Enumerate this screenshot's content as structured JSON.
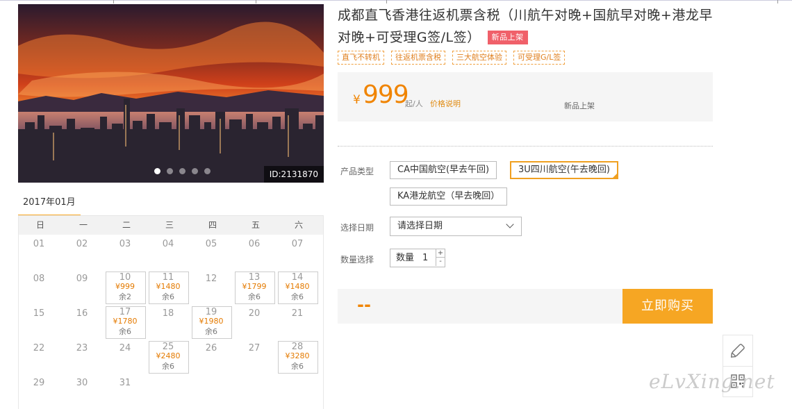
{
  "hero": {
    "image_id": "ID:2131870",
    "slide_count": 5,
    "active_slide": 1
  },
  "calendar": {
    "month": "2017年01月",
    "weekdays": [
      "日",
      "一",
      "二",
      "三",
      "四",
      "五",
      "六"
    ],
    "rows": [
      [
        {
          "d": "01"
        },
        {
          "d": "02"
        },
        {
          "d": "03"
        },
        {
          "d": "04"
        },
        {
          "d": "05"
        },
        {
          "d": "06"
        },
        {
          "d": "07"
        }
      ],
      [
        {
          "d": "08"
        },
        {
          "d": "09"
        },
        {
          "d": "10",
          "price": "¥999",
          "rem": "余2"
        },
        {
          "d": "11",
          "price": "¥1480",
          "rem": "余6"
        },
        {
          "d": "12"
        },
        {
          "d": "13",
          "price": "¥1799",
          "rem": "余6"
        },
        {
          "d": "14",
          "price": "¥1480",
          "rem": "余6"
        }
      ],
      [
        {
          "d": "15"
        },
        {
          "d": "16"
        },
        {
          "d": "17",
          "price": "¥1780",
          "rem": "余6"
        },
        {
          "d": "18"
        },
        {
          "d": "19",
          "price": "¥1980",
          "rem": "余6"
        },
        {
          "d": "20"
        },
        {
          "d": "21"
        }
      ],
      [
        {
          "d": "22"
        },
        {
          "d": "23"
        },
        {
          "d": "24"
        },
        {
          "d": "25",
          "price": "¥2480",
          "rem": "余6"
        },
        {
          "d": "26"
        },
        {
          "d": "27"
        },
        {
          "d": "28",
          "price": "¥3280",
          "rem": "余6"
        }
      ],
      [
        {
          "d": "29"
        },
        {
          "d": "30"
        },
        {
          "d": "31"
        },
        null,
        null,
        null,
        null
      ]
    ]
  },
  "product": {
    "title": "成都直飞香港往返机票含税（川航午对晚+国航早对晚+港龙早对晚+可受理G签/L签）",
    "badge": "新品上架",
    "tags": [
      "直飞不转机",
      "往返机票含税",
      "三大航空体验",
      "可受理G/L签"
    ],
    "price_symbol": "¥",
    "price": "999",
    "price_unit": "起/人",
    "price_explain": "价格说明",
    "status": "新品上架"
  },
  "form": {
    "type_label": "产品类型",
    "options": [
      "CA中国航空(早去午回)",
      "3U四川航空(午去晚回)",
      "KA港龙航空（早去晚回）"
    ],
    "selected_option": 1,
    "date_label": "选择日期",
    "date_placeholder": "请选择日期",
    "qty_label": "数量选择",
    "qty_field_label": "数量",
    "qty_value": "1",
    "plus": "+",
    "minus": "-"
  },
  "buy": {
    "total": "--",
    "button": "立即购买"
  },
  "watermark": "eLvXing.net",
  "colors": {
    "accent": "#f6a623",
    "price": "#f08400",
    "badge": "#f0606a"
  }
}
